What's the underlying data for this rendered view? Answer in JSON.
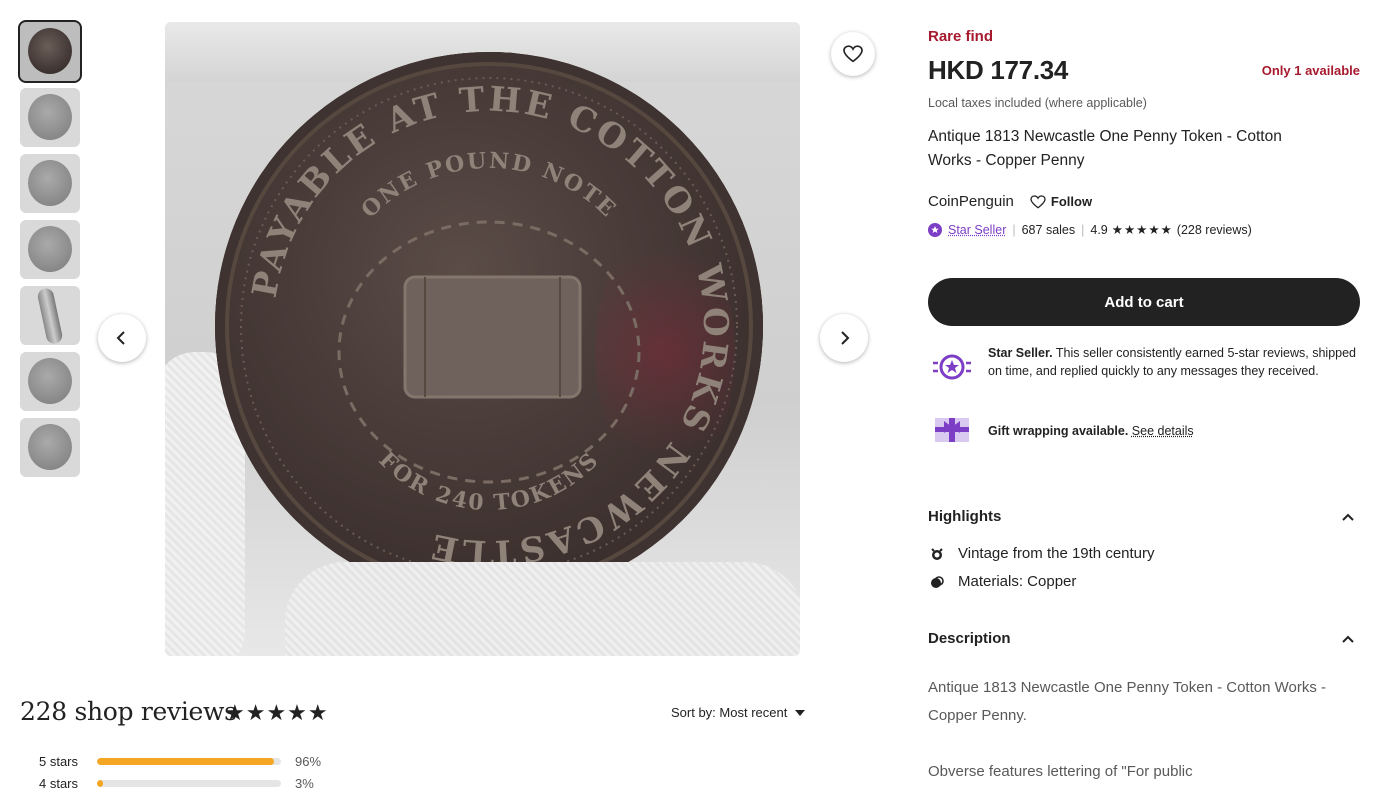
{
  "thumbnails": [
    {
      "name": "thumb-1",
      "active": true
    },
    {
      "name": "thumb-2",
      "active": false
    },
    {
      "name": "thumb-3",
      "active": false
    },
    {
      "name": "thumb-4",
      "active": false
    },
    {
      "name": "thumb-5",
      "active": false
    },
    {
      "name": "thumb-6",
      "active": false
    },
    {
      "name": "thumb-7",
      "active": false
    }
  ],
  "coin": {
    "outer_text": "PAYABLE AT THE COTTON WORKS NEWCASTLE",
    "inner_top": "ONE POUND NOTE",
    "inner_bottom": "FOR 240 TOKENS"
  },
  "product": {
    "badge": "Rare find",
    "price": "HKD 177.34",
    "availability": "Only 1 available",
    "taxes": "Local taxes included (where applicable)",
    "title": "Antique 1813 Newcastle One Penny Token - Cotton Works - Copper Penny"
  },
  "seller": {
    "name": "CoinPenguin",
    "follow_label": "Follow",
    "star_seller_label": "Star Seller",
    "sales": "687 sales",
    "rating": "4.9",
    "stars": "★★★★★",
    "reviews": "(228 reviews)"
  },
  "cart": {
    "label": "Add to cart"
  },
  "star_seller_info": {
    "bold": "Star Seller.",
    "text": " This seller consistently earned 5-star reviews, shipped on time, and replied quickly to any messages they received."
  },
  "gift": {
    "bold": "Gift wrapping available.",
    "link": "See details"
  },
  "highlights": {
    "heading": "Highlights",
    "items": [
      "Vintage from the 19th century",
      "Materials: Copper"
    ]
  },
  "description": {
    "heading": "Description",
    "para1": "Antique 1813 Newcastle One Penny Token - Cotton Works - Copper Penny.",
    "para2": "Obverse features lettering of \"For public"
  },
  "reviews": {
    "title": "228 shop reviews",
    "stars": "★★★★★",
    "sort_label": "Sort by: Most recent",
    "breakdown": [
      {
        "label": "5 stars",
        "percent": 96,
        "percent_text": "96%"
      },
      {
        "label": "4 stars",
        "percent": 3,
        "percent_text": "3%"
      }
    ]
  },
  "colors": {
    "accent_red": "#a61a2e",
    "star_seller_purple": "#7d3ec6",
    "rating_bar": "#f5a623",
    "button_dark": "#222222"
  }
}
